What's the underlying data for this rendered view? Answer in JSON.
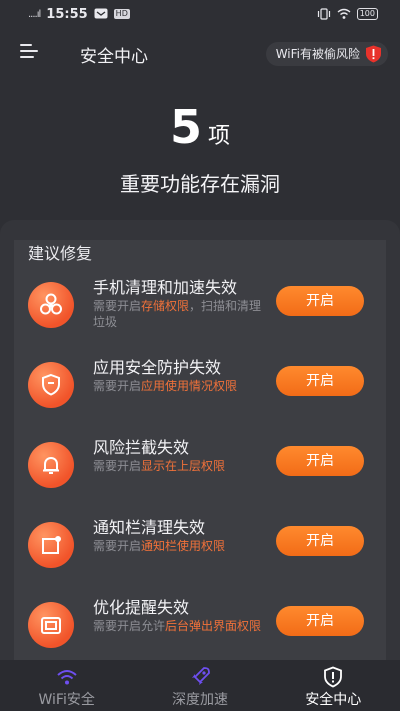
{
  "status_bar": {
    "signal": "....ıl",
    "time": "15:55",
    "badge": "HD",
    "battery": "100"
  },
  "header": {
    "title": "安全中心",
    "wifi_risk": "WiFi有被偷风险"
  },
  "hero": {
    "count": "5",
    "unit": "项",
    "description": "重要功能存在漏洞"
  },
  "section": {
    "title": "建议修复"
  },
  "items": [
    {
      "title": "手机清理和加速失效",
      "desc_pre": "需要开启",
      "desc_highlight": "存储权限",
      "desc_post": "，扫描和清理垃圾",
      "button": "开启",
      "icon": "fan-icon"
    },
    {
      "title": "应用安全防护失效",
      "desc_pre": "需要开启",
      "desc_highlight": "应用使用情况权限",
      "desc_post": "",
      "button": "开启",
      "icon": "shield-icon"
    },
    {
      "title": "风险拦截失效",
      "desc_pre": "需要开启",
      "desc_highlight": "显示在上层权限",
      "desc_post": "",
      "button": "开启",
      "icon": "bell-icon"
    },
    {
      "title": "通知栏清理失效",
      "desc_pre": "需要开启",
      "desc_highlight": "通知栏使用权限",
      "desc_post": "",
      "button": "开启",
      "icon": "notification-icon"
    },
    {
      "title": "优化提醒失效",
      "desc_pre": "需要开启允许",
      "desc_highlight": "后台弹出界面权限",
      "desc_post": "",
      "button": "开启",
      "icon": "popup-window-icon"
    }
  ],
  "bottom_nav": [
    {
      "label": "WiFi安全",
      "active": false
    },
    {
      "label": "深度加速",
      "active": false
    },
    {
      "label": "安全中心",
      "active": true
    }
  ],
  "colors": {
    "accent": "#f26b17",
    "highlight": "#f0713a",
    "background": "#2e2f34"
  }
}
